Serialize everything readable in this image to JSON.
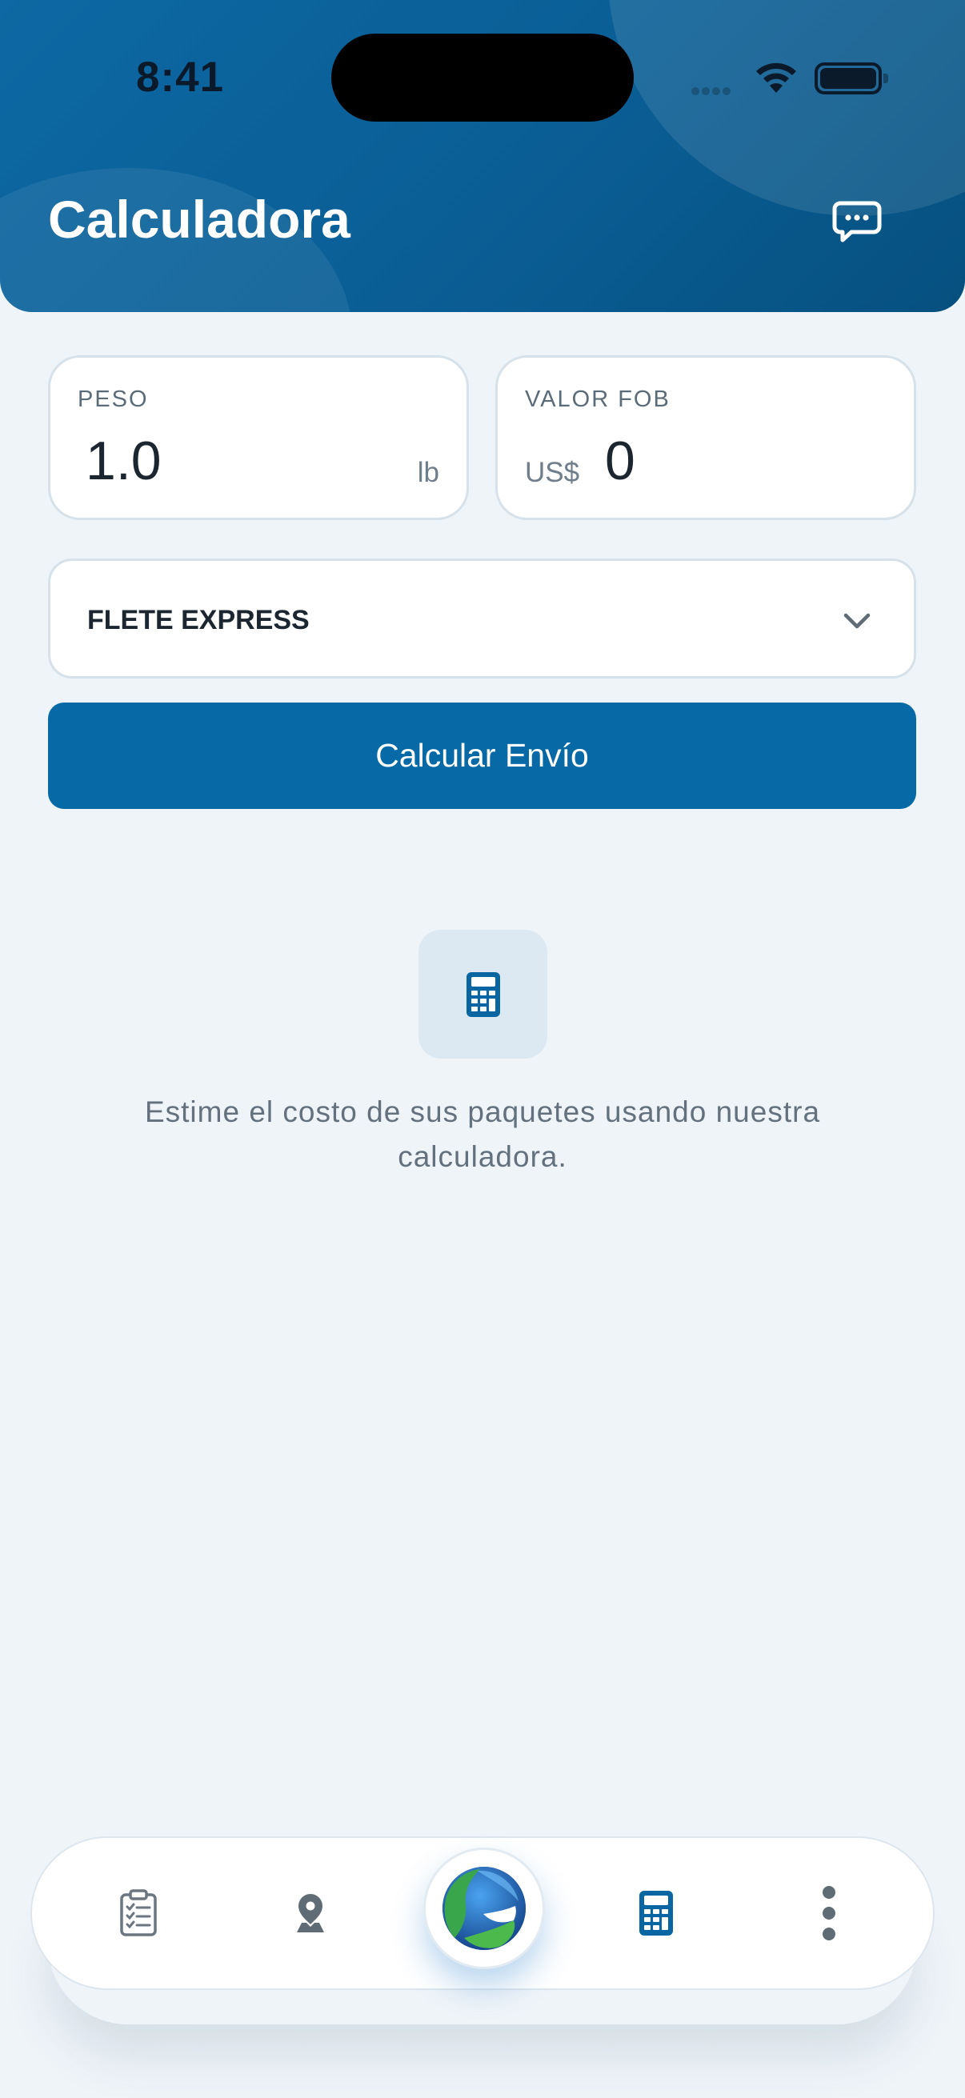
{
  "status_bar": {
    "time": "8:41"
  },
  "header": {
    "title": "Calculadora",
    "chat_icon": "chat-bubble-icon"
  },
  "form": {
    "peso": {
      "label": "PESO",
      "value": "1.0",
      "unit": "lb"
    },
    "valor_fob": {
      "label": "VALOR FOB",
      "currency": "US$",
      "value": "0"
    },
    "service_select": {
      "selected": "FLETE EXPRESS"
    },
    "submit_label": "Calcular Envío"
  },
  "empty_state": {
    "icon": "calculator-icon",
    "message": "Estime el costo de sus paquetes usando nuestra calculadora."
  },
  "bottom_nav": {
    "items": [
      {
        "icon": "clipboard-icon",
        "active": false
      },
      {
        "icon": "location-pin-icon",
        "active": false
      },
      {
        "icon": "globe-logo-icon",
        "active": false
      },
      {
        "icon": "calculator-icon",
        "active": true
      },
      {
        "icon": "more-vertical-icon",
        "active": false
      }
    ]
  },
  "colors": {
    "primary": "#0769a6",
    "header_gradient_start": "#0d68a3",
    "header_gradient_end": "#06507f",
    "background": "#eff4f9",
    "text_dark": "#1b2631",
    "text_muted": "#62717d",
    "nav_inactive": "#5f6b75"
  }
}
